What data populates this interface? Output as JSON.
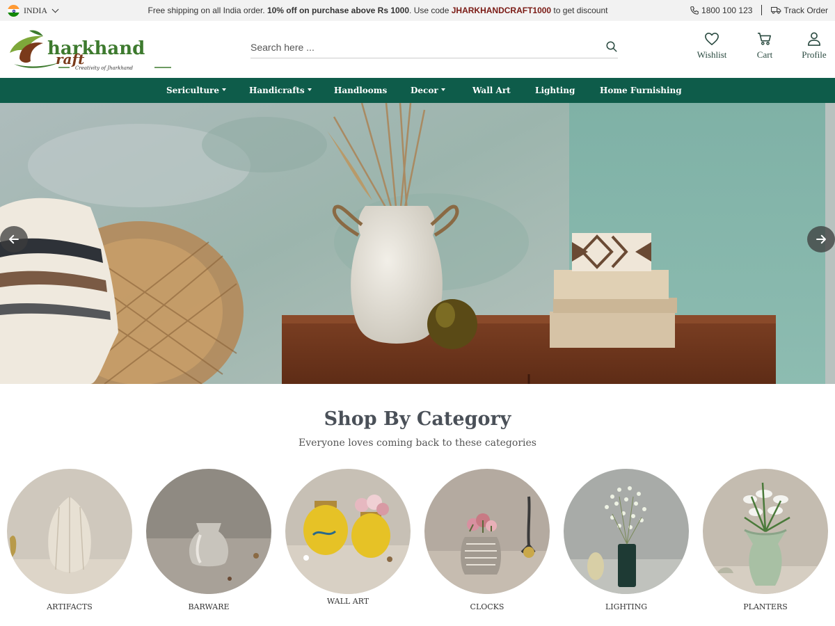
{
  "topbar": {
    "country": "INDIA",
    "promo_prefix": "Free shipping on all India order. ",
    "promo_bold": "10% off on purchase above Rs 1000",
    "promo_middle": ". Use code ",
    "promo_code": "JHARKHANDCRAFT1000",
    "promo_suffix": " to get discount",
    "phone": "1800 100 123",
    "track_order": "Track Order"
  },
  "logo": {
    "line1": "Jharkhand",
    "line2": "Craft",
    "tagline": "Creativity of Jharkhand"
  },
  "search": {
    "placeholder": "Search here ..."
  },
  "header_icons": {
    "wishlist": "Wishlist",
    "cart": "Cart",
    "profile": "Profile"
  },
  "nav": {
    "items": [
      {
        "label": "Sericulture",
        "dropdown": true
      },
      {
        "label": "Handicrafts",
        "dropdown": true
      },
      {
        "label": "Handlooms",
        "dropdown": false
      },
      {
        "label": "Decor",
        "dropdown": true
      },
      {
        "label": "Wall Art",
        "dropdown": false
      },
      {
        "label": "Lighting",
        "dropdown": false
      },
      {
        "label": "Home Furnishing",
        "dropdown": false
      }
    ]
  },
  "category": {
    "title": "Shop By Category",
    "subtitle": "Everyone loves coming back to these categories",
    "items": [
      {
        "label": "ARTIFACTS"
      },
      {
        "label": "BARWARE"
      },
      {
        "label": "WALL ART"
      },
      {
        "label": "CLOCKS"
      },
      {
        "label": "LIGHTING"
      },
      {
        "label": "PLANTERS"
      }
    ]
  },
  "colors": {
    "nav_bg": "#0e5c4a",
    "topbar_bg": "#f2f2f2",
    "promo_code": "#7a1a14",
    "logo_green": "#3d7a2e",
    "logo_brown": "#7a3a1a"
  }
}
